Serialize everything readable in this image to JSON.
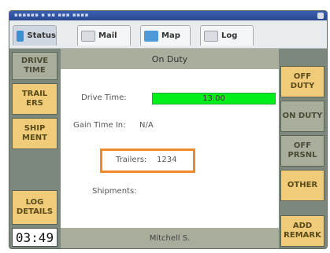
{
  "tabs": [
    {
      "label": "Status",
      "icon": "status-icon",
      "color": "#3f8fcf"
    },
    {
      "label": "Mail",
      "icon": "mail-icon",
      "color": "#d9dde2"
    },
    {
      "label": "Map",
      "icon": "map-icon",
      "color": "#4e9ad8"
    },
    {
      "label": "Log",
      "icon": "log-icon",
      "color": "#d9dde2"
    }
  ],
  "left_buttons": {
    "drive_time": "DRIVE TIME",
    "trailers": "TRAIL ERS",
    "shipment": "SHIP MENT",
    "log_details": "LOG DETAILS"
  },
  "clock": "03:49",
  "main": {
    "status_title": "On Duty",
    "drive_time_label": "Drive Time:",
    "drive_time_value": "13:00",
    "gain_time_label": "Gain Time In:",
    "gain_time_value": "N/A",
    "trailers_label": "Trailers:",
    "trailers_value": "1234",
    "shipments_label": "Shipments:",
    "driver_name": "Mitchell S."
  },
  "right_buttons": {
    "off_duty": "OFF DUTY",
    "on_duty": "ON DUTY",
    "off_prsnl": "OFF PRSNL",
    "other": "OTHER",
    "add_remark": "ADD REMARK"
  },
  "colors": {
    "accent_yellow": "#f0cc7a",
    "panel_gray": "#a9ad9b",
    "drive_bar_green": "#00ef1a",
    "highlight_orange": "#ee8a2a"
  }
}
